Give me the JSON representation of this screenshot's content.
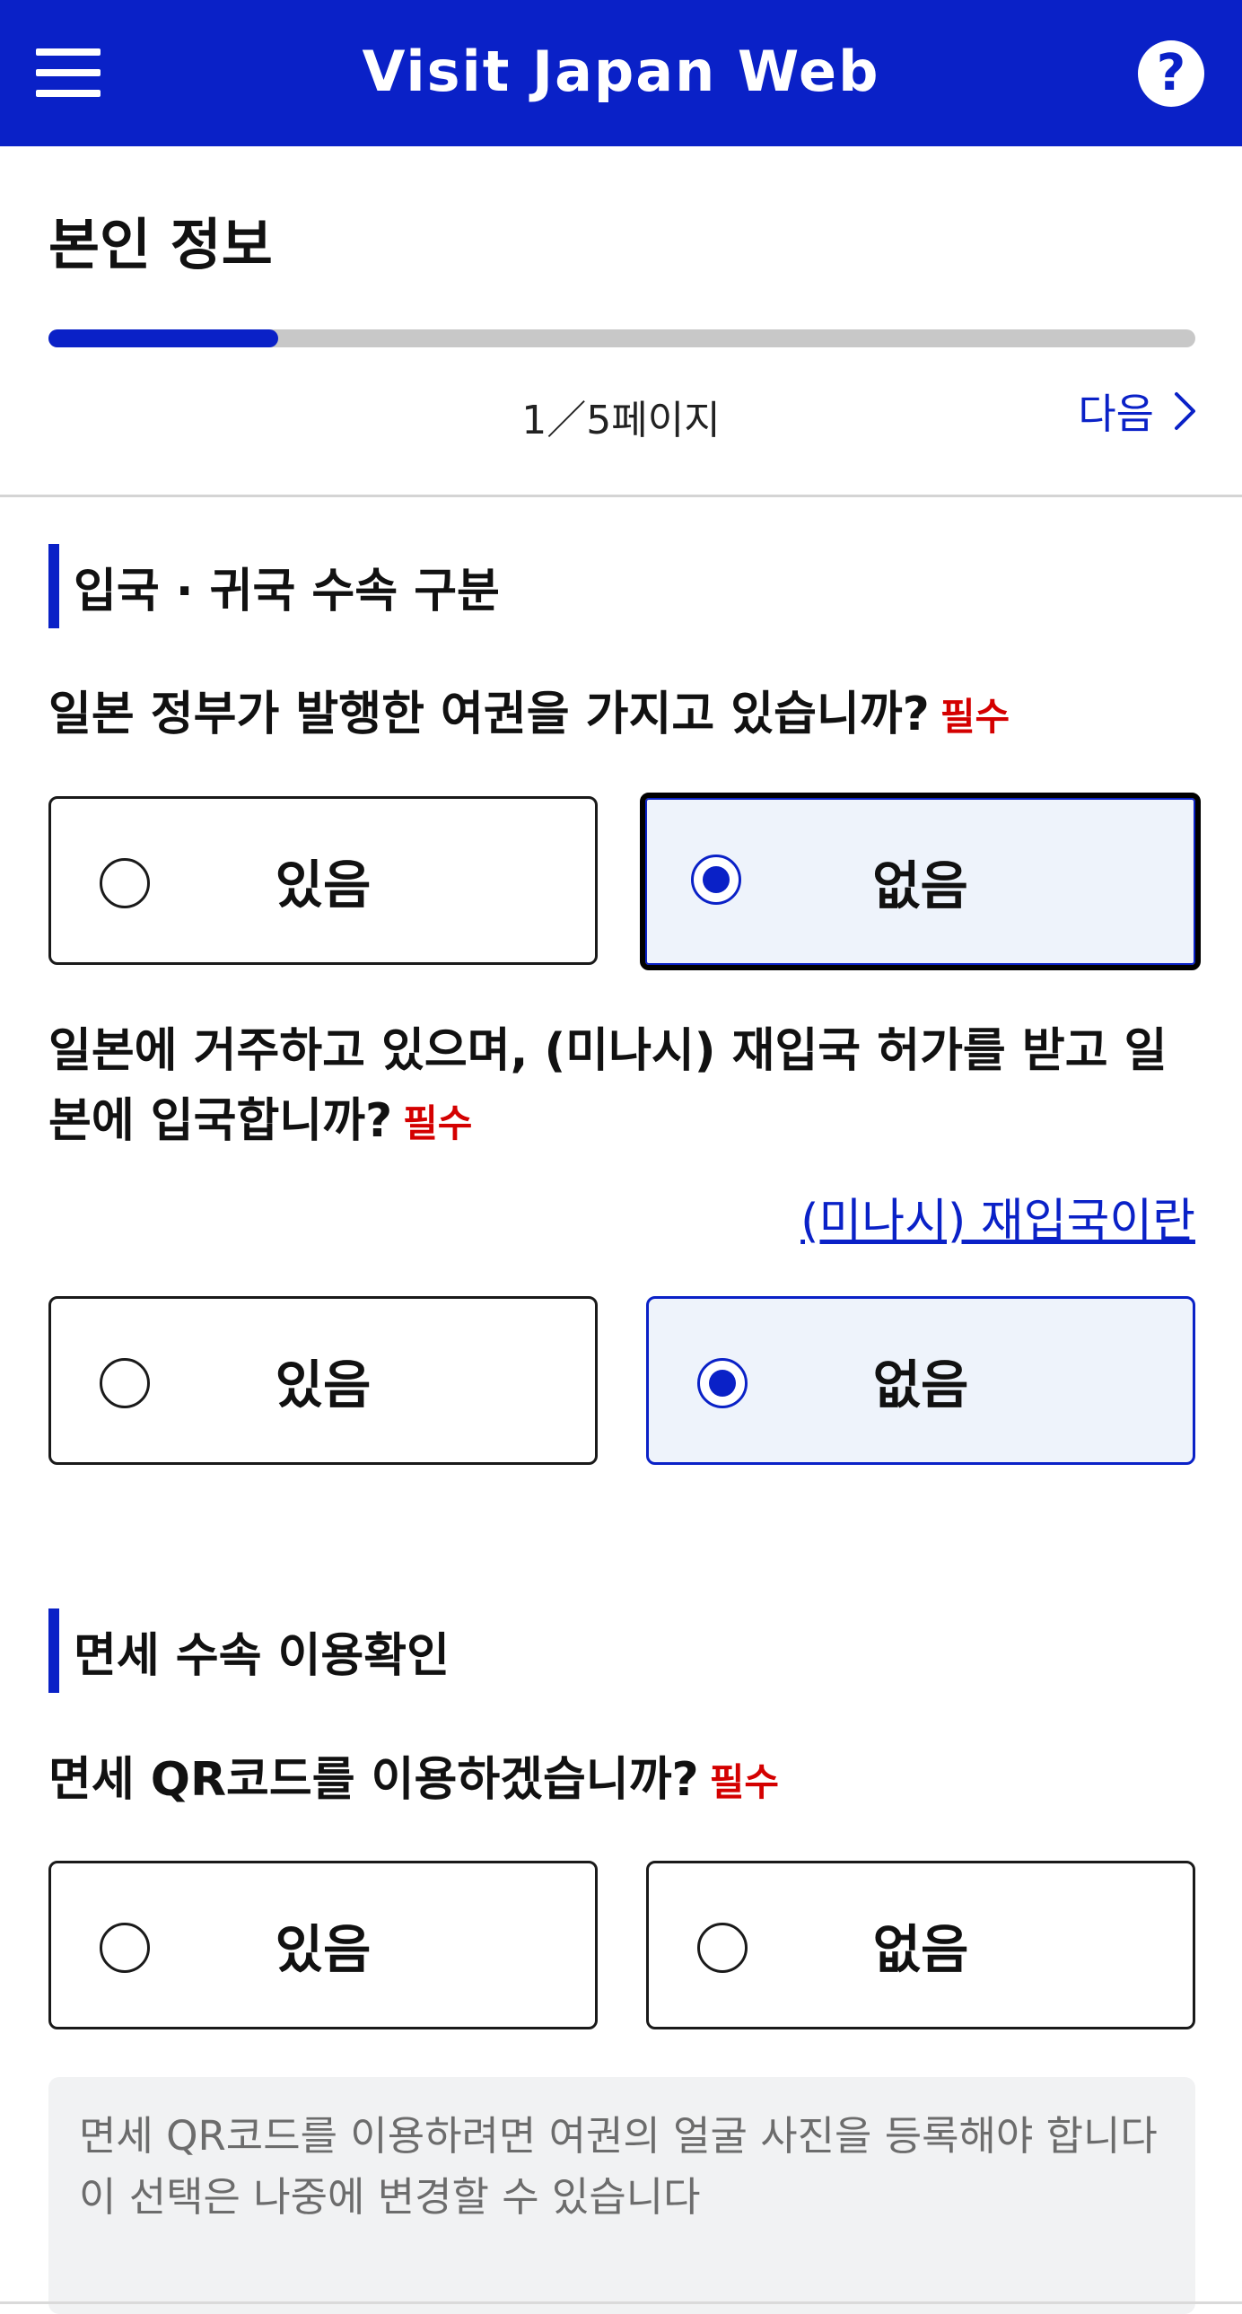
{
  "header": {
    "title": "Visit Japan Web",
    "help_symbol": "?",
    "menu_icon": "hamburger-menu-icon",
    "help_icon": "question-circle-icon",
    "brand_color": "#0a21c7"
  },
  "page": {
    "title": "본인 정보",
    "progress": 0.2,
    "indicator": "1／5페이지",
    "next_label": "다음"
  },
  "section1": {
    "heading": "입국 · 귀국 수속 구분",
    "q1": {
      "text": "일본 정부가 발행한 여권을 가지고 있습니까?",
      "required": "필수",
      "options": [
        {
          "label": "있음",
          "selected": false
        },
        {
          "label": "없음",
          "selected": true
        }
      ]
    },
    "q2": {
      "text": "일본에 거주하고 있으며, (미나시) 재입국 허가를 받고 일본에 입국합니까?",
      "required": "필수",
      "help_link": "(미나시) 재입국이란",
      "options": [
        {
          "label": "있음",
          "selected": false
        },
        {
          "label": "없음",
          "selected": true
        }
      ]
    }
  },
  "section2": {
    "heading": "면세 수속 이용확인",
    "q3": {
      "text": "면세 QR코드를 이용하겠습니까?",
      "required": "필수",
      "options": [
        {
          "label": "있음",
          "selected": false
        },
        {
          "label": "없음",
          "selected": false
        }
      ]
    },
    "note_line1": "면세 QR코드를 이용하려면 여권의 얼굴 사진을 등록해야 합니다",
    "note_line2": "이 선택은 나중에 변경할 수 있습니다"
  },
  "colors": {
    "accent": "#0a21c7",
    "required": "#d40000",
    "selected_bg": "#eef3fb"
  }
}
